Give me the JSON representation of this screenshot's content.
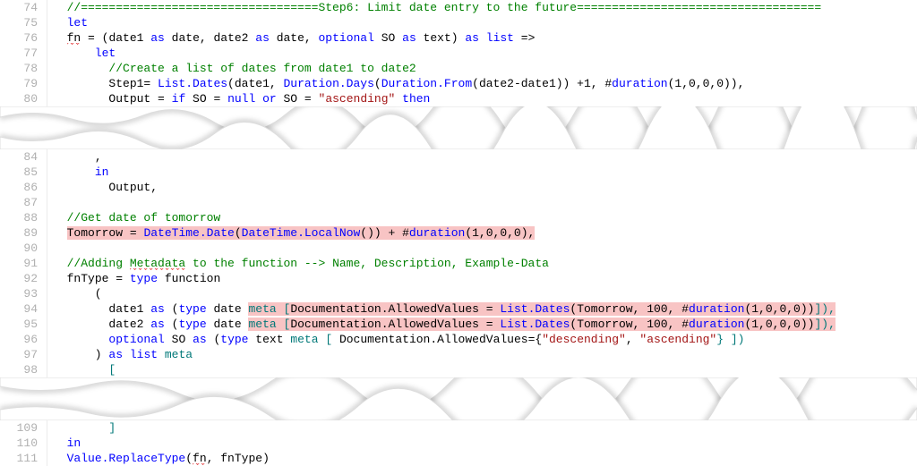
{
  "section1": [
    {
      "num": "74",
      "tokens": [
        [
          "  ",
          "b"
        ],
        [
          "//==================================Step6: Limit date entry to the future===================================",
          "g"
        ]
      ]
    },
    {
      "num": "75",
      "tokens": [
        [
          "  ",
          "b"
        ],
        [
          "let",
          "blue"
        ]
      ]
    },
    {
      "num": "76",
      "tokens": [
        [
          "  ",
          "b"
        ],
        [
          "fn",
          "b",
          "sq"
        ],
        [
          " = (",
          "b"
        ],
        [
          "date1 ",
          "b"
        ],
        [
          "as",
          "blue"
        ],
        [
          " date, ",
          "b"
        ],
        [
          "date2 ",
          "b"
        ],
        [
          "as",
          "blue"
        ],
        [
          " date, ",
          "b"
        ],
        [
          "optional",
          "blue"
        ],
        [
          " SO ",
          "b"
        ],
        [
          "as",
          "blue"
        ],
        [
          " text) ",
          "b"
        ],
        [
          "as",
          "blue"
        ],
        [
          " ",
          "b"
        ],
        [
          "list",
          "blue"
        ],
        [
          " =>",
          "b"
        ]
      ]
    },
    {
      "num": "77",
      "tokens": [
        [
          "      ",
          "b"
        ],
        [
          "let",
          "blue"
        ]
      ]
    },
    {
      "num": "78",
      "tokens": [
        [
          "        ",
          "b"
        ],
        [
          "//Create a list of dates from date1 to date2",
          "g"
        ]
      ]
    },
    {
      "num": "79",
      "tokens": [
        [
          "        ",
          "b"
        ],
        [
          "Step1= ",
          "b"
        ],
        [
          "List.Dates",
          "blue"
        ],
        [
          "(",
          "b"
        ],
        [
          "date1, ",
          "b"
        ],
        [
          "Duration.Days",
          "blue"
        ],
        [
          "(",
          "b"
        ],
        [
          "Duration.From",
          "blue"
        ],
        [
          "(",
          "b"
        ],
        [
          "date2-date1)) +1, #",
          "b"
        ],
        [
          "duration",
          "blue"
        ],
        [
          "(1,0,0,0)),",
          "b"
        ]
      ]
    },
    {
      "num": "80",
      "tokens": [
        [
          "        ",
          "b"
        ],
        [
          "Output = ",
          "b"
        ],
        [
          "if",
          "blue"
        ],
        [
          " SO = ",
          "b"
        ],
        [
          "null",
          "blue"
        ],
        [
          " ",
          "b"
        ],
        [
          "or",
          "blue"
        ],
        [
          " SO = ",
          "b"
        ],
        [
          "\"ascending\"",
          "red"
        ],
        [
          " ",
          "b"
        ],
        [
          "then",
          "blue"
        ]
      ]
    }
  ],
  "section2": [
    {
      "num": "84",
      "tokens": [
        [
          "      ",
          "b"
        ],
        [
          ",",
          "b"
        ]
      ]
    },
    {
      "num": "85",
      "tokens": [
        [
          "      ",
          "b"
        ],
        [
          "in",
          "blue"
        ]
      ]
    },
    {
      "num": "86",
      "tokens": [
        [
          "        ",
          "b"
        ],
        [
          "Output,",
          "b"
        ]
      ]
    },
    {
      "num": "87",
      "tokens": [
        [
          "",
          "b"
        ]
      ]
    },
    {
      "num": "88",
      "tokens": [
        [
          "  ",
          "b"
        ],
        [
          "//Get date of tomorrow",
          "g"
        ]
      ]
    },
    {
      "num": "89",
      "tokens": [
        [
          "  ",
          "b"
        ],
        [
          "Tomorrow = ",
          "b",
          "h"
        ],
        [
          "DateTime.Date",
          "blue",
          "h"
        ],
        [
          "(",
          "b",
          "h"
        ],
        [
          "DateTime.LocalNow",
          "blue",
          "h"
        ],
        [
          "()) + #",
          "b",
          "h"
        ],
        [
          "duration",
          "blue",
          "h"
        ],
        [
          "(1,0,0,0),",
          "b",
          "h"
        ]
      ]
    },
    {
      "num": "90",
      "tokens": [
        [
          "",
          "b"
        ]
      ]
    },
    {
      "num": "91",
      "tokens": [
        [
          "  ",
          "b"
        ],
        [
          "//Adding ",
          "g"
        ],
        [
          "Metadata",
          "g",
          "sq"
        ],
        [
          " to the function --> Name, Description, Example-Data",
          "g"
        ]
      ]
    },
    {
      "num": "92",
      "tokens": [
        [
          "  ",
          "b"
        ],
        [
          "fnType = ",
          "b"
        ],
        [
          "type",
          "blue"
        ],
        [
          " function",
          "b"
        ]
      ]
    },
    {
      "num": "93",
      "tokens": [
        [
          "      (",
          "b"
        ]
      ]
    },
    {
      "num": "94",
      "tokens": [
        [
          "        ",
          "b"
        ],
        [
          "date1 ",
          "b"
        ],
        [
          "as",
          "blue"
        ],
        [
          " (",
          "b"
        ],
        [
          "type",
          "blue"
        ],
        [
          " date ",
          "b"
        ],
        [
          "meta ",
          "teal",
          "h"
        ],
        [
          "[",
          "teal",
          "h"
        ],
        [
          "Documentation.AllowedValues = ",
          "b",
          "h"
        ],
        [
          "List.Dates",
          "blue",
          "h"
        ],
        [
          "(",
          "b",
          "h"
        ],
        [
          "Tomorrow, 100, #",
          "b",
          "h"
        ],
        [
          "duration",
          "blue",
          "h"
        ],
        [
          "(1,0,0,0))",
          "b",
          "h"
        ],
        [
          "]",
          "teal",
          "h"
        ],
        [
          "),",
          "teal",
          "h"
        ]
      ]
    },
    {
      "num": "95",
      "tokens": [
        [
          "        ",
          "b"
        ],
        [
          "date2 ",
          "b"
        ],
        [
          "as",
          "blue"
        ],
        [
          " (",
          "b"
        ],
        [
          "type",
          "blue"
        ],
        [
          " date ",
          "b"
        ],
        [
          "meta ",
          "teal",
          "h"
        ],
        [
          "[",
          "teal",
          "h"
        ],
        [
          "Documentation.AllowedValues = ",
          "b",
          "h"
        ],
        [
          "List.Dates",
          "blue",
          "h"
        ],
        [
          "(",
          "b",
          "h"
        ],
        [
          "Tomorrow, 100, #",
          "b",
          "h"
        ],
        [
          "duration",
          "blue",
          "h"
        ],
        [
          "(1,0,0,0))",
          "b",
          "h"
        ],
        [
          "]",
          "teal",
          "h"
        ],
        [
          "),",
          "teal",
          "h"
        ]
      ]
    },
    {
      "num": "96",
      "tokens": [
        [
          "        ",
          "b"
        ],
        [
          "optional",
          "blue"
        ],
        [
          " SO ",
          "b"
        ],
        [
          "as",
          "blue"
        ],
        [
          " (",
          "b"
        ],
        [
          "type",
          "blue"
        ],
        [
          " text ",
          "b"
        ],
        [
          "meta ",
          "teal"
        ],
        [
          "[ ",
          "teal"
        ],
        [
          "Documentation.AllowedValues={",
          "b"
        ],
        [
          "\"descending\"",
          "red"
        ],
        [
          ", ",
          "b"
        ],
        [
          "\"ascending\"",
          "red"
        ],
        [
          "} ",
          "teal"
        ],
        [
          "])",
          "teal"
        ]
      ]
    },
    {
      "num": "97",
      "tokens": [
        [
          "      ) ",
          "b"
        ],
        [
          "as",
          "blue"
        ],
        [
          " ",
          "b"
        ],
        [
          "list",
          "blue"
        ],
        [
          " ",
          "b"
        ],
        [
          "meta",
          "teal"
        ]
      ]
    },
    {
      "num": "98",
      "tokens": [
        [
          "        ",
          "b"
        ],
        [
          "[",
          "teal"
        ]
      ]
    }
  ],
  "section3": [
    {
      "num": "109",
      "tokens": [
        [
          "        ",
          "b"
        ],
        [
          "]",
          "teal"
        ]
      ]
    },
    {
      "num": "110",
      "tokens": [
        [
          "  ",
          "b"
        ],
        [
          "in",
          "blue"
        ]
      ]
    },
    {
      "num": "111",
      "tokens": [
        [
          "  ",
          "b"
        ],
        [
          "Value.ReplaceType",
          "blue"
        ],
        [
          "(",
          "b"
        ],
        [
          "fn",
          "b",
          "sq"
        ],
        [
          ", fnType)",
          "b"
        ]
      ]
    }
  ]
}
